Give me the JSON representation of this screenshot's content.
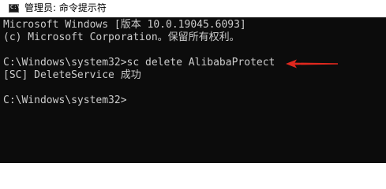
{
  "window": {
    "title": "管理员: 命令提示符",
    "icon": "cmd-icon",
    "icon_glyph": "C:\\"
  },
  "console": {
    "lines": [
      "Microsoft Windows [版本 10.0.19045.6093]",
      "(c) Microsoft Corporation。保留所有权利。",
      "C:\\Windows\\system32>sc delete AlibabaProtect",
      "[SC] DeleteService 成功",
      "C:\\Windows\\system32>"
    ],
    "background_color": "#0c0c0c",
    "text_color": "#cccccc"
  },
  "annotation": {
    "icon": "red-arrow-icon",
    "color": "#e0281e"
  }
}
